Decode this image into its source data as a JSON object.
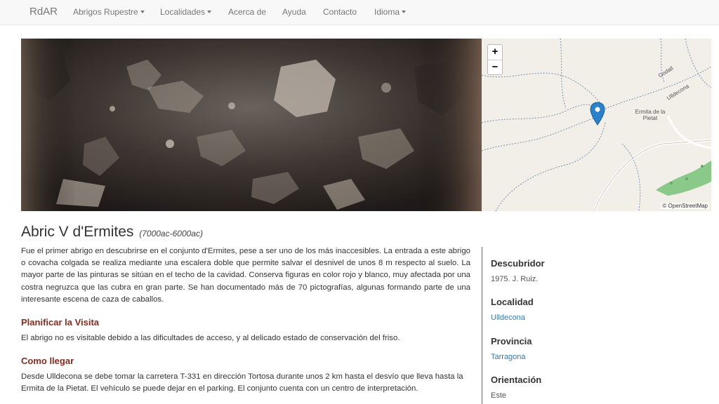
{
  "navbar": {
    "brand": "RdAR",
    "items": [
      {
        "label": "Abrigos Rupestre",
        "dropdown": true
      },
      {
        "label": "Localidades",
        "dropdown": true
      },
      {
        "label": "Acerca de",
        "dropdown": false
      },
      {
        "label": "Ayuda",
        "dropdown": false
      },
      {
        "label": "Contacto",
        "dropdown": false
      },
      {
        "label": "Idioma",
        "dropdown": true
      }
    ]
  },
  "map": {
    "zoom_in": "+",
    "zoom_out": "−",
    "place_label": "Ermita de la Pietat",
    "road_label_1": "Godall",
    "road_label_2": "Ulldecona",
    "attribution": "© OpenStreetMap",
    "marker_color": "#2a81cb",
    "green_area_color": "#8bc98b"
  },
  "site": {
    "name": "Abric V d'Ermites",
    "period": "(7000ac-6000ac)",
    "description": "Fue el primer abrigo en descubrirse en el conjunto d'Ermites, pese a ser uno de los más inaccesibles. La entrada a este abrigo o covacha colgada se realiza mediante una escalera doble que permite salvar el desnivel de unos 8 m respecto al suelo. La mayor parte de las pinturas se sitúan en el techo de la cavidad. Conserva figuras en color rojo y blanco, muy afectada por una costra negruzca que las cubra en gran parte. Se han documentado más de 70 pictografías, algunas formando parte de una interesante escena de caza de caballos."
  },
  "sections": [
    {
      "heading": "Planificar la Visita",
      "text": "El abrigo no es visitable debido a las dificultades de acceso, y al delicado estado de conservación del friso."
    },
    {
      "heading": "Como llegar",
      "text": "Desde Ulldecona se debe tomar la carretera T-331 en dirección Tortosa durante unos 2 km hasta el desvío que lleva hasta la Ermita de la Pietat. El vehículo se puede dejar en el parking. El conjunto cuenta con un centro de interpretación."
    }
  ],
  "sidebar": {
    "descubridor_label": "Descubridor",
    "descubridor_value": "1975. J. Ruiz.",
    "localidad_label": "Localidad",
    "localidad_value": "Ulldecona",
    "provincia_label": "Provincia",
    "provincia_value": "Tarragona",
    "orientacion_label": "Orientación",
    "orientacion_value": "Este"
  },
  "colors": {
    "heading_accent": "#8b2a1d",
    "link": "#337ab7",
    "navbar_bg": "#f8f8f8"
  }
}
